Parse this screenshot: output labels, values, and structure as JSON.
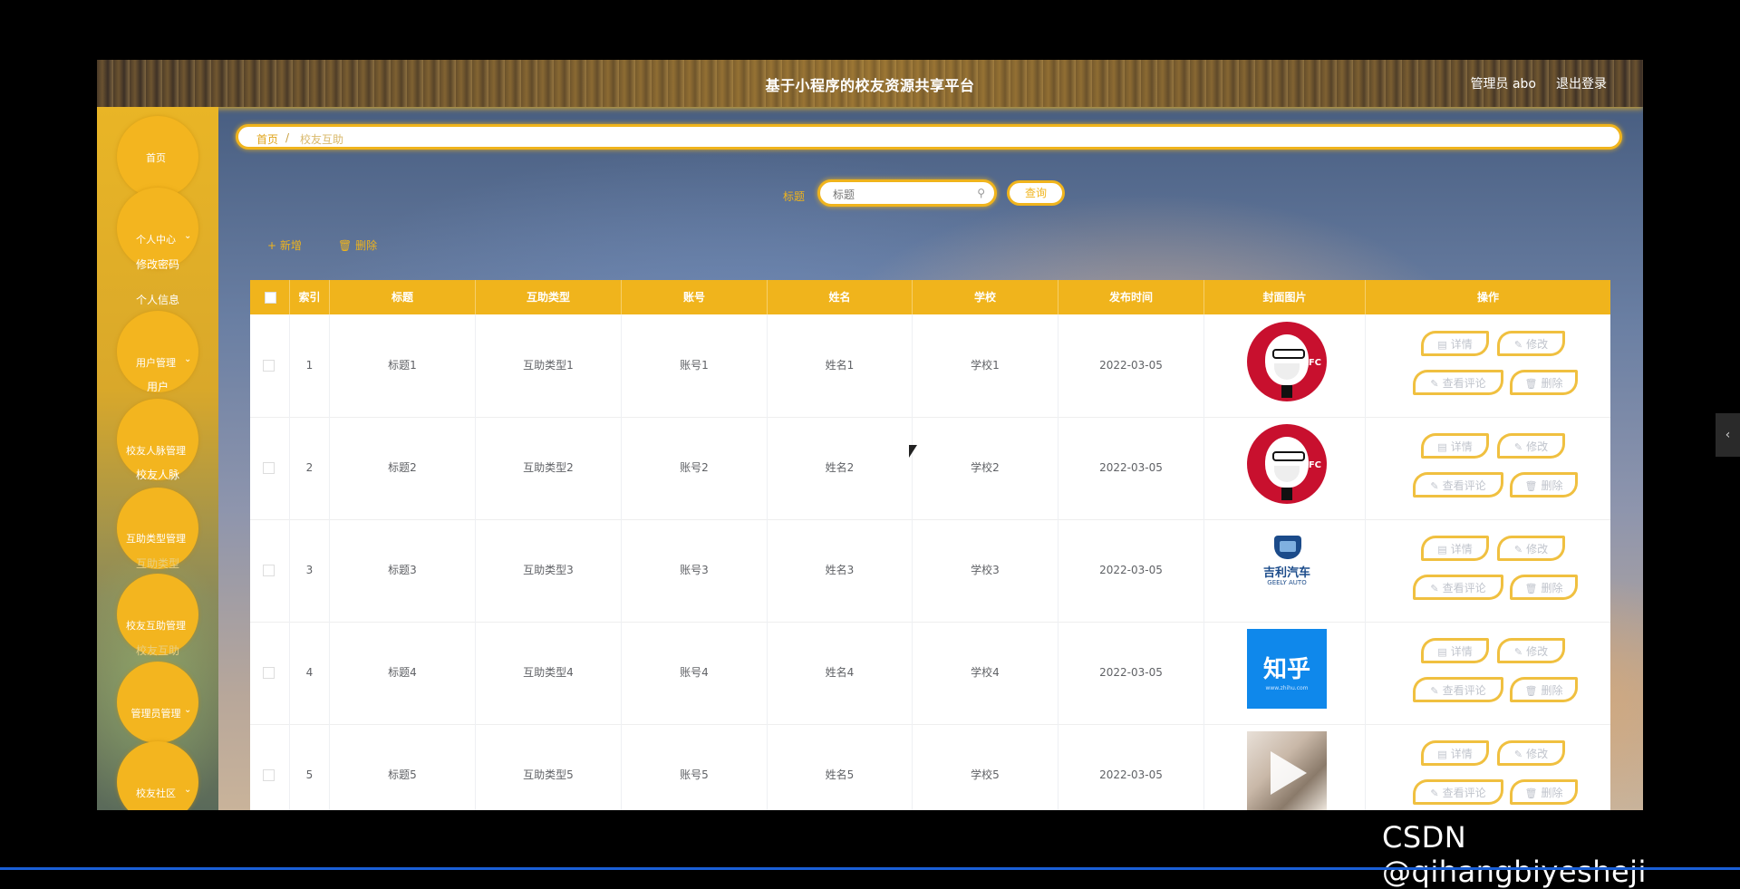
{
  "header": {
    "title": "基于小程序的校友资源共享平台",
    "user": "管理员 abo",
    "logout": "退出登录"
  },
  "sidebar": {
    "home": "首页",
    "personal": "个人中心",
    "personal_sub": [
      "修改密码",
      "个人信息"
    ],
    "users": "用户管理",
    "users_sub": [
      "用户"
    ],
    "network": "校友人脉管理",
    "network_sub": [
      "校友人脉"
    ],
    "helptype": "互助类型管理",
    "helptype_sub": [
      "互助类型"
    ],
    "mutual": "校友互助管理",
    "mutual_sub": [
      "校友互助"
    ],
    "admin": "管理员管理",
    "community": "校友社区"
  },
  "breadcrumb": {
    "home": "首页",
    "sep": "/",
    "current": "校友互助"
  },
  "search": {
    "label": "标题",
    "placeholder": "标题",
    "button": "查询"
  },
  "toolbar": {
    "add": "+ 新增",
    "delete": "删除"
  },
  "table": {
    "columns": [
      "索引",
      "标题",
      "互助类型",
      "账号",
      "姓名",
      "学校",
      "发布时间",
      "封面图片",
      "操作"
    ],
    "rows": [
      {
        "index": "1",
        "title": "标题1",
        "type": "互助类型1",
        "account": "账号1",
        "name": "姓名1",
        "school": "学校1",
        "date": "2022-03-05",
        "cover": "kfc-logo"
      },
      {
        "index": "2",
        "title": "标题2",
        "type": "互助类型2",
        "account": "账号2",
        "name": "姓名2",
        "school": "学校2",
        "date": "2022-03-05",
        "cover": "kfc-logo"
      },
      {
        "index": "3",
        "title": "标题3",
        "type": "互助类型3",
        "account": "账号3",
        "name": "姓名3",
        "school": "学校3",
        "date": "2022-03-05",
        "cover": "geely-logo"
      },
      {
        "index": "4",
        "title": "标题4",
        "type": "互助类型4",
        "account": "账号4",
        "name": "姓名4",
        "school": "学校4",
        "date": "2022-03-05",
        "cover": "zhihu-logo"
      },
      {
        "index": "5",
        "title": "标题5",
        "type": "互助类型5",
        "account": "账号5",
        "name": "姓名5",
        "school": "学校5",
        "date": "2022-03-05",
        "cover": "photo-thumbnail"
      }
    ],
    "actions": {
      "detail": "详情",
      "edit": "修改",
      "comments": "查看评论",
      "delete": "删除"
    }
  },
  "logos": {
    "kfc": "KFC",
    "geely_cn": "吉利汽车",
    "geely_en": "GEELY AUTO",
    "zhihu_cn": "知乎",
    "zhihu_en": "www.zhihu.com"
  },
  "watermark": "CSDN @qihangbiyesheji",
  "colors": {
    "accent": "#f0b41c",
    "header_text": "#ffffff"
  }
}
